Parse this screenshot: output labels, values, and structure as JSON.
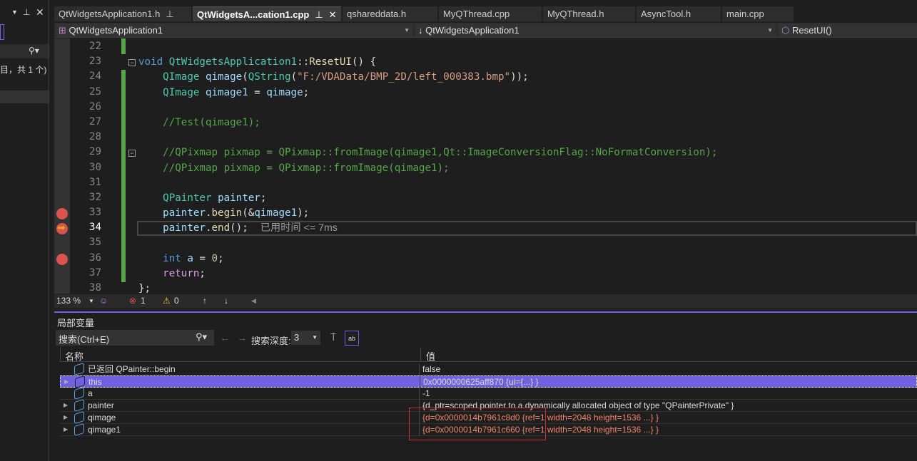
{
  "left_panel": {
    "snippet": "目，共 1 个)"
  },
  "tabs": [
    {
      "label": "QtWidgetsApplication1.h",
      "pinned": true,
      "active": false
    },
    {
      "label": "QtWidgetsA...cation1.cpp",
      "pinned": true,
      "active": true
    },
    {
      "label": "qshareddata.h",
      "active": false
    },
    {
      "label": "MyQThread.cpp",
      "active": false
    },
    {
      "label": "MyQThread.h",
      "active": false
    },
    {
      "label": "AsyncTool.h",
      "active": false
    },
    {
      "label": "main.cpp",
      "active": false
    }
  ],
  "navbar": {
    "project": "QtWidgetsApplication1",
    "scope": "QtWidgetsApplication1",
    "member": "ResetUI()"
  },
  "code": {
    "current_line": 34,
    "breakpoints": [
      33,
      36
    ],
    "lines": [
      {
        "n": 22,
        "t": []
      },
      {
        "n": 23,
        "t": [
          [
            "kw",
            "void"
          ],
          [
            "p",
            " "
          ],
          [
            "cls",
            "QtWidgetsApplication1"
          ],
          [
            "p",
            "::"
          ],
          [
            "fn",
            "ResetUI"
          ],
          [
            "p",
            "() {"
          ]
        ]
      },
      {
        "n": 24,
        "t": [
          [
            "p",
            "    "
          ],
          [
            "cls",
            "QImage"
          ],
          [
            "p",
            " "
          ],
          [
            "var",
            "qimage"
          ],
          [
            "p",
            "("
          ],
          [
            "cls",
            "QString"
          ],
          [
            "p",
            "("
          ],
          [
            "str",
            "\"F:/VDAData/BMP_2D/left_000383.bmp\""
          ],
          [
            "p",
            "));"
          ]
        ]
      },
      {
        "n": 25,
        "t": [
          [
            "p",
            "    "
          ],
          [
            "cls",
            "QImage"
          ],
          [
            "p",
            " "
          ],
          [
            "var",
            "qimage1"
          ],
          [
            "p",
            " = "
          ],
          [
            "var",
            "qimage"
          ],
          [
            "p",
            ";"
          ]
        ]
      },
      {
        "n": 26,
        "t": []
      },
      {
        "n": 27,
        "t": [
          [
            "p",
            "    "
          ],
          [
            "cm",
            "//Test(qimage1);"
          ]
        ]
      },
      {
        "n": 28,
        "t": []
      },
      {
        "n": 29,
        "t": [
          [
            "p",
            "    "
          ],
          [
            "cm",
            "//QPixmap pixmap = QPixmap::fromImage(qimage1,Qt::ImageConversionFlag::NoFormatConversion);"
          ]
        ]
      },
      {
        "n": 30,
        "t": [
          [
            "p",
            "    "
          ],
          [
            "cm",
            "//QPixmap pixmap = QPixmap::fromImage(qimage1);"
          ]
        ]
      },
      {
        "n": 31,
        "t": []
      },
      {
        "n": 32,
        "t": [
          [
            "p",
            "    "
          ],
          [
            "cls",
            "QPainter"
          ],
          [
            "p",
            " "
          ],
          [
            "var",
            "painter"
          ],
          [
            "p",
            ";"
          ]
        ]
      },
      {
        "n": 33,
        "t": [
          [
            "p",
            "    "
          ],
          [
            "var",
            "painter"
          ],
          [
            "p",
            "."
          ],
          [
            "fn",
            "begin"
          ],
          [
            "p",
            "(&"
          ],
          [
            "var",
            "qimage1"
          ],
          [
            "p",
            ");"
          ]
        ]
      },
      {
        "n": 34,
        "t": [
          [
            "p",
            "    "
          ],
          [
            "var",
            "painter"
          ],
          [
            "p",
            "."
          ],
          [
            "fn",
            "end"
          ],
          [
            "p",
            "();  "
          ],
          [
            "hint",
            "已用时间 <= 7ms"
          ]
        ]
      },
      {
        "n": 35,
        "t": []
      },
      {
        "n": 36,
        "t": [
          [
            "p",
            "    "
          ],
          [
            "kw",
            "int"
          ],
          [
            "p",
            " "
          ],
          [
            "var",
            "a"
          ],
          [
            "p",
            " = "
          ],
          [
            "num",
            "0"
          ],
          [
            "p",
            ";"
          ]
        ]
      },
      {
        "n": 37,
        "t": [
          [
            "p",
            "    "
          ],
          [
            "ctl",
            "return"
          ],
          [
            "p",
            ";"
          ]
        ]
      },
      {
        "n": 38,
        "t": [
          [
            "p",
            "};"
          ]
        ]
      }
    ]
  },
  "colors": {
    "kw": "#569cd6",
    "cls": "#4ec9b0",
    "fn": "#dcdcaa",
    "var": "#9cdcfe",
    "str": "#d69d85",
    "cm": "#57a64a",
    "p": "#dcdcdc",
    "num": "#b5cea8",
    "ctl": "#d8a0df",
    "hint": "#9a9a9a",
    "accent": "#7160e8"
  },
  "status": {
    "zoom": "133 %",
    "errors": "1",
    "warnings": "0"
  },
  "locals": {
    "title": "局部变量",
    "search_placeholder": "搜索(Ctrl+E)",
    "depth_label": "搜索深度:",
    "depth": "3",
    "col_name": "名称",
    "col_value": "值",
    "rows": [
      {
        "name": "已返回 QPainter::begin",
        "value": "false",
        "expandable": false
      },
      {
        "name": "this",
        "value": "0x0000000625aff870 {ui={...} }",
        "expandable": true,
        "selected": true
      },
      {
        "name": "a",
        "value": "-1",
        "expandable": false
      },
      {
        "name": "painter",
        "value": "{d_ptr=scoped pointer to a dynamically allocated object of type \"QPainterPrivate\" }",
        "expandable": true
      },
      {
        "name": "qimage",
        "value": "{d=0x0000014b7961c8d0 {ref=1 width=2048 height=1536 ...} }",
        "expandable": true,
        "changed": true
      },
      {
        "name": "qimage1",
        "value": "{d=0x0000014b7961c660 {ref=1 width=2048 height=1536 ...} }",
        "expandable": true,
        "changed": true
      }
    ]
  }
}
